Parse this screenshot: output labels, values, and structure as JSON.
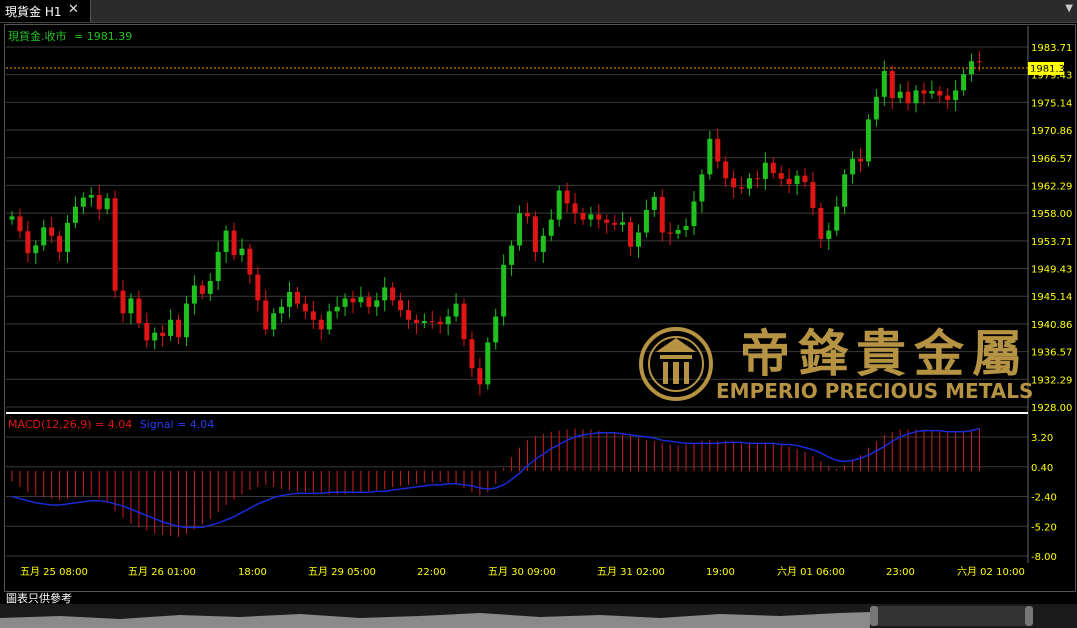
{
  "tab": {
    "title": "現貨金 H1",
    "close": "✕"
  },
  "price_panel": {
    "label": "現貨金.收市",
    "value_text": "= 1981.39",
    "last": 1981.39,
    "y_ticks": [
      "1983.71",
      "1979.43",
      "1975.14",
      "1970.86",
      "1966.57",
      "1962.29",
      "1958.00",
      "1953.71",
      "1949.43",
      "1945.14",
      "1940.86",
      "1936.57",
      "1932.29",
      "1928.00"
    ],
    "current_label": "1981.39"
  },
  "macd_panel": {
    "label": "MACD(12,26,9) = 4.04",
    "signal_label": "Signal = 4.04",
    "y_ticks": [
      "3.20",
      "0.40",
      "-2.40",
      "-5.20",
      "-8.00"
    ]
  },
  "x_ticks": [
    "五月 25 08:00",
    "五月 26 01:00",
    "18:00",
    "五月 29 05:00",
    "22:00",
    "五月 30 09:00",
    "五月 31 02:00",
    "19:00",
    "六月 01 06:00",
    "23:00",
    "六月 02 10:00"
  ],
  "watermark": {
    "chinese": "帝鋒貴金屬",
    "english": "EMPERIO PRECIOUS METALS"
  },
  "footnote": "圖表只供參考",
  "colors": {
    "up": "#21c021",
    "down": "#e01515",
    "macd_hist": "#cc1f1f",
    "signal": "#1a2bd8",
    "grid": "#3a3a3a",
    "axis_text": "#ffff00",
    "price_line": "#ff9900",
    "gold": "#c9a34a"
  },
  "chart_data": {
    "type": "candlestick",
    "ylim": [
      1928.0,
      1985.5
    ],
    "closes": [
      1957.5,
      1955.2,
      1951.8,
      1953.0,
      1955.8,
      1954.5,
      1952.0,
      1956.5,
      1959.0,
      1960.4,
      1960.8,
      1958.6,
      1960.3,
      1946.0,
      1942.5,
      1944.8,
      1941.0,
      1938.3,
      1939.5,
      1939.0,
      1941.5,
      1938.8,
      1944.0,
      1946.8,
      1945.5,
      1947.5,
      1952.0,
      1955.3,
      1951.5,
      1952.5,
      1948.5,
      1944.5,
      1940.0,
      1942.5,
      1943.5,
      1945.8,
      1944.0,
      1942.8,
      1941.5,
      1940.0,
      1942.8,
      1943.5,
      1944.8,
      1944.2,
      1945.0,
      1943.5,
      1944.5,
      1946.5,
      1944.5,
      1943.0,
      1941.5,
      1941.0,
      1941.3,
      1941.2,
      1940.8,
      1942.0,
      1944.0,
      1938.5,
      1934.0,
      1931.5,
      1938.0,
      1942.0,
      1950.0,
      1953.0,
      1958.0,
      1957.5,
      1952.0,
      1954.5,
      1957.0,
      1961.5,
      1959.5,
      1958.0,
      1957.0,
      1957.8,
      1957.0,
      1956.5,
      1956.2,
      1956.6,
      1952.8,
      1955.0,
      1958.5,
      1960.5,
      1955.0,
      1954.8,
      1955.4,
      1956.0,
      1959.8,
      1964.0,
      1969.5,
      1966.0,
      1963.4,
      1962.0,
      1961.8,
      1963.4,
      1963.3,
      1965.8,
      1964.2,
      1963.3,
      1962.5,
      1963.8,
      1962.8,
      1958.8,
      1954.0,
      1955.3,
      1959.0,
      1964.0,
      1966.4,
      1966.0,
      1972.5,
      1976.0,
      1980.0,
      1975.8,
      1976.8,
      1975.0,
      1977.0,
      1976.5,
      1976.9,
      1976.2,
      1975.5,
      1977.0,
      1979.5,
      1981.5,
      1981.4
    ],
    "macd": [
      -1.0,
      -1.5,
      -2.0,
      -2.3,
      -2.5,
      -2.6,
      -2.7,
      -2.6,
      -2.5,
      -2.3,
      -2.2,
      -2.6,
      -3.0,
      -3.8,
      -4.4,
      -5.0,
      -5.3,
      -5.6,
      -5.9,
      -6.0,
      -6.1,
      -6.2,
      -5.9,
      -5.5,
      -5.0,
      -4.5,
      -3.9,
      -3.2,
      -2.7,
      -2.2,
      -1.8,
      -1.5,
      -1.3,
      -1.5,
      -1.7,
      -1.8,
      -1.9,
      -2.0,
      -2.1,
      -2.1,
      -2.2,
      -2.2,
      -2.2,
      -2.1,
      -2.0,
      -1.9,
      -1.8,
      -1.7,
      -1.5,
      -1.4,
      -1.3,
      -1.2,
      -1.1,
      -1.1,
      -1.0,
      -1.1,
      -1.2,
      -1.6,
      -2.0,
      -2.3,
      -2.0,
      -1.2,
      0.3,
      1.3,
      2.2,
      2.9,
      3.3,
      3.5,
      3.7,
      3.8,
      3.9,
      4.0,
      3.9,
      3.9,
      3.8,
      3.7,
      3.6,
      3.5,
      3.3,
      3.1,
      2.9,
      2.8,
      2.6,
      2.5,
      2.4,
      2.5,
      2.6,
      2.8,
      2.9,
      2.8,
      2.8,
      2.7,
      2.6,
      2.6,
      2.6,
      2.7,
      2.6,
      2.5,
      2.3,
      2.1,
      1.8,
      1.4,
      0.9,
      0.4,
      0.2,
      0.5,
      1.0,
      1.5,
      2.2,
      2.8,
      3.4,
      3.7,
      3.9,
      3.9,
      3.9,
      3.9,
      3.8,
      3.7,
      3.6,
      3.6,
      3.7,
      3.9,
      4.0
    ],
    "signal": [
      -2.4,
      -2.6,
      -2.8,
      -3.0,
      -3.1,
      -3.2,
      -3.2,
      -3.1,
      -3.0,
      -2.9,
      -2.8,
      -2.8,
      -2.9,
      -3.1,
      -3.3,
      -3.6,
      -3.9,
      -4.2,
      -4.5,
      -4.8,
      -5.0,
      -5.2,
      -5.3,
      -5.3,
      -5.3,
      -5.1,
      -4.9,
      -4.6,
      -4.3,
      -3.9,
      -3.5,
      -3.1,
      -2.8,
      -2.5,
      -2.3,
      -2.2,
      -2.1,
      -2.1,
      -2.1,
      -2.1,
      -2.0,
      -2.0,
      -2.0,
      -2.0,
      -2.0,
      -2.0,
      -1.9,
      -1.9,
      -1.8,
      -1.7,
      -1.6,
      -1.5,
      -1.4,
      -1.3,
      -1.3,
      -1.2,
      -1.2,
      -1.3,
      -1.4,
      -1.6,
      -1.7,
      -1.6,
      -1.3,
      -0.8,
      -0.2,
      0.5,
      1.1,
      1.6,
      2.1,
      2.5,
      2.9,
      3.2,
      3.4,
      3.5,
      3.6,
      3.6,
      3.6,
      3.5,
      3.4,
      3.3,
      3.2,
      3.1,
      2.9,
      2.8,
      2.7,
      2.6,
      2.6,
      2.6,
      2.6,
      2.6,
      2.7,
      2.7,
      2.7,
      2.6,
      2.6,
      2.6,
      2.6,
      2.5,
      2.5,
      2.4,
      2.2,
      2.0,
      1.7,
      1.3,
      1.0,
      0.9,
      1.0,
      1.2,
      1.5,
      1.9,
      2.3,
      2.8,
      3.2,
      3.5,
      3.7,
      3.8,
      3.8,
      3.8,
      3.7,
      3.7,
      3.7,
      3.8,
      4.0
    ],
    "macd_ylim": [
      -8.0,
      4.6
    ]
  }
}
